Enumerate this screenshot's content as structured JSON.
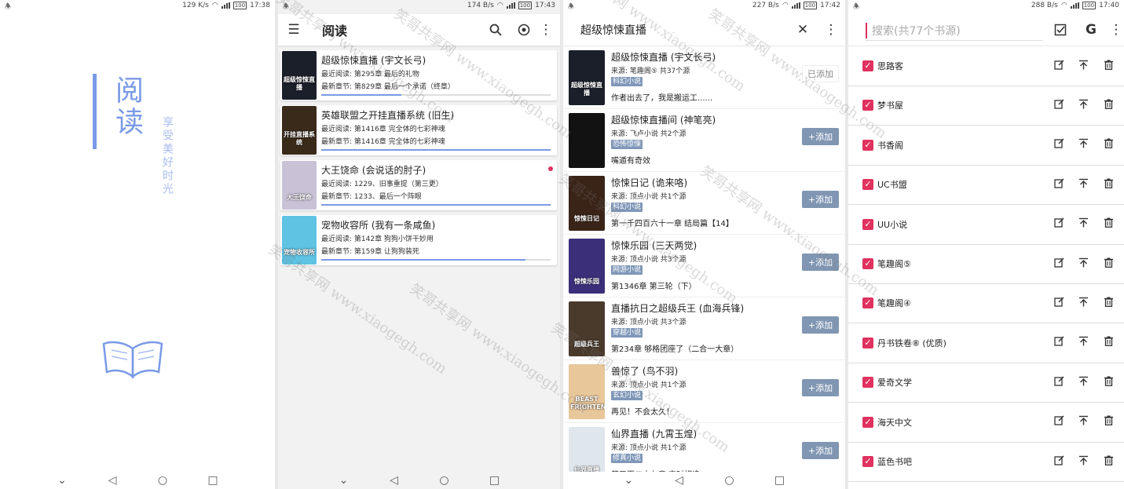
{
  "panel1": {
    "status": {
      "speed": "129 K/s",
      "battery": "100",
      "time": "17:38"
    },
    "splash": {
      "title": "阅读",
      "subtitle": "享受美好时光"
    }
  },
  "panel2": {
    "status": {
      "speed": "174 B/s",
      "battery": "100",
      "time": "17:43"
    },
    "title": "阅读",
    "books": [
      {
        "name": "超级惊悚直播 (宇文长弓)",
        "recent": "最近阅读: 第295章 最后的礼物",
        "latest": "最新章节: 第829章 最后一个承诺（终章）",
        "progress": 0.35,
        "cover_text": "超级惊悚直播",
        "cover_color": "#1b1f2a",
        "unread": false
      },
      {
        "name": "英雄联盟之开挂直播系统 (旧生)",
        "recent": "最近阅读: 第1416章 完全体的七彩神魂",
        "latest": "最新章节: 第1416章 完全体的七彩神魂",
        "progress": 1.0,
        "cover_text": "开挂直播系统",
        "cover_color": "#3a2a1a",
        "unread": false
      },
      {
        "name": "大王饶命 (会说话的肘子)",
        "recent": "最近阅读: 1229、旧事重提（第三更）",
        "latest": "最新章节: 1233、最后一个阵眼",
        "progress": 1.0,
        "cover_text": "大王饶命",
        "cover_color": "#c9c2d6",
        "unread": true
      },
      {
        "name": "宠物收容所 (我有一条咸鱼)",
        "recent": "最近阅读: 第142章 狗狗小饼干妙用",
        "latest": "最新章节: 第159章 让狗狗装死",
        "progress": 0.89,
        "cover_text": "宠物收容所",
        "cover_color": "#5fc3e4",
        "unread": false
      }
    ]
  },
  "panel3": {
    "status": {
      "speed": "227 B/s",
      "battery": "100",
      "time": "17:42"
    },
    "query": "超级惊悚直播",
    "results": [
      {
        "name": "超级惊悚直播 (宇文长弓)",
        "source": "来源: 笔趣阁⑤ 共37个源",
        "tag": "科幻小说",
        "latest": "作者出去了，我是搬运工......",
        "button": "已添加",
        "added": true,
        "cover_text": "超级惊悚直播",
        "cover_color": "#1b1f2a"
      },
      {
        "name": "超级惊悚直播间 (神笔亮)",
        "source": "来源: 飞卢小说 共2个源",
        "tag": "恐怖惊悚",
        "latest": "嘴遁有奇效",
        "button": "+添加",
        "added": false,
        "cover_text": "",
        "cover_color": "#121212"
      },
      {
        "name": "惊悚日记 (诡来咯)",
        "source": "来源: 顶点小说 共1个源",
        "tag": "科幻小说",
        "latest": "第一千四百六十一章 结局篇【14】",
        "button": "+添加",
        "added": false,
        "cover_text": "惊悚日记",
        "cover_color": "#3a2418"
      },
      {
        "name": "惊悚乐园 (三天两觉)",
        "source": "来源: 顶点小说 共3个源",
        "tag": "网游小说",
        "latest": "第1346章 第三轮（下）",
        "button": "+添加",
        "added": false,
        "cover_text": "惊悚乐园",
        "cover_color": "#3b2f7a"
      },
      {
        "name": "直播抗日之超级兵王 (血海兵锋)",
        "source": "来源: 顶点小说 共3个源",
        "tag": "穿越小说",
        "latest": "第234章 够格团座了（二合一大章）",
        "button": "+添加",
        "added": false,
        "cover_text": "超级兵王",
        "cover_color": "#4a3a2c"
      },
      {
        "name": "兽惊了 (鸟不羽)",
        "source": "来源: 顶点小说 共1个源",
        "tag": "玄幻小说",
        "latest": "再见！不会太久！",
        "button": "+添加",
        "added": false,
        "cover_text": "BEAST FRIGHTEN",
        "cover_color": "#e8c79a"
      },
      {
        "name": "仙界直播 (九霄玉煌)",
        "source": "来源: 顶点小说 共1个源",
        "tag": "修真小说",
        "latest": "第三百二十七章 空时相逢",
        "button": "+添加",
        "added": false,
        "cover_text": "仙界直播",
        "cover_color": "#dfe6ec"
      }
    ]
  },
  "panel4": {
    "status": {
      "speed": "288 B/s",
      "battery": "100",
      "time": "17:40"
    },
    "search_placeholder": "搜索(共77个书源)",
    "sources": [
      "思路客",
      "梦书屋",
      "书香阁",
      "UC书盟",
      "UU小说",
      "笔趣阁⑤",
      "笔趣阁④",
      "丹书铁卷⑧ (优质)",
      "爱奇文学",
      "海天中文",
      "蓝色书吧"
    ]
  },
  "watermark": "笑哥共享网 www.xiaogegh.com",
  "accent": "#7a9ae6",
  "checkbox_color": "#e0325f"
}
